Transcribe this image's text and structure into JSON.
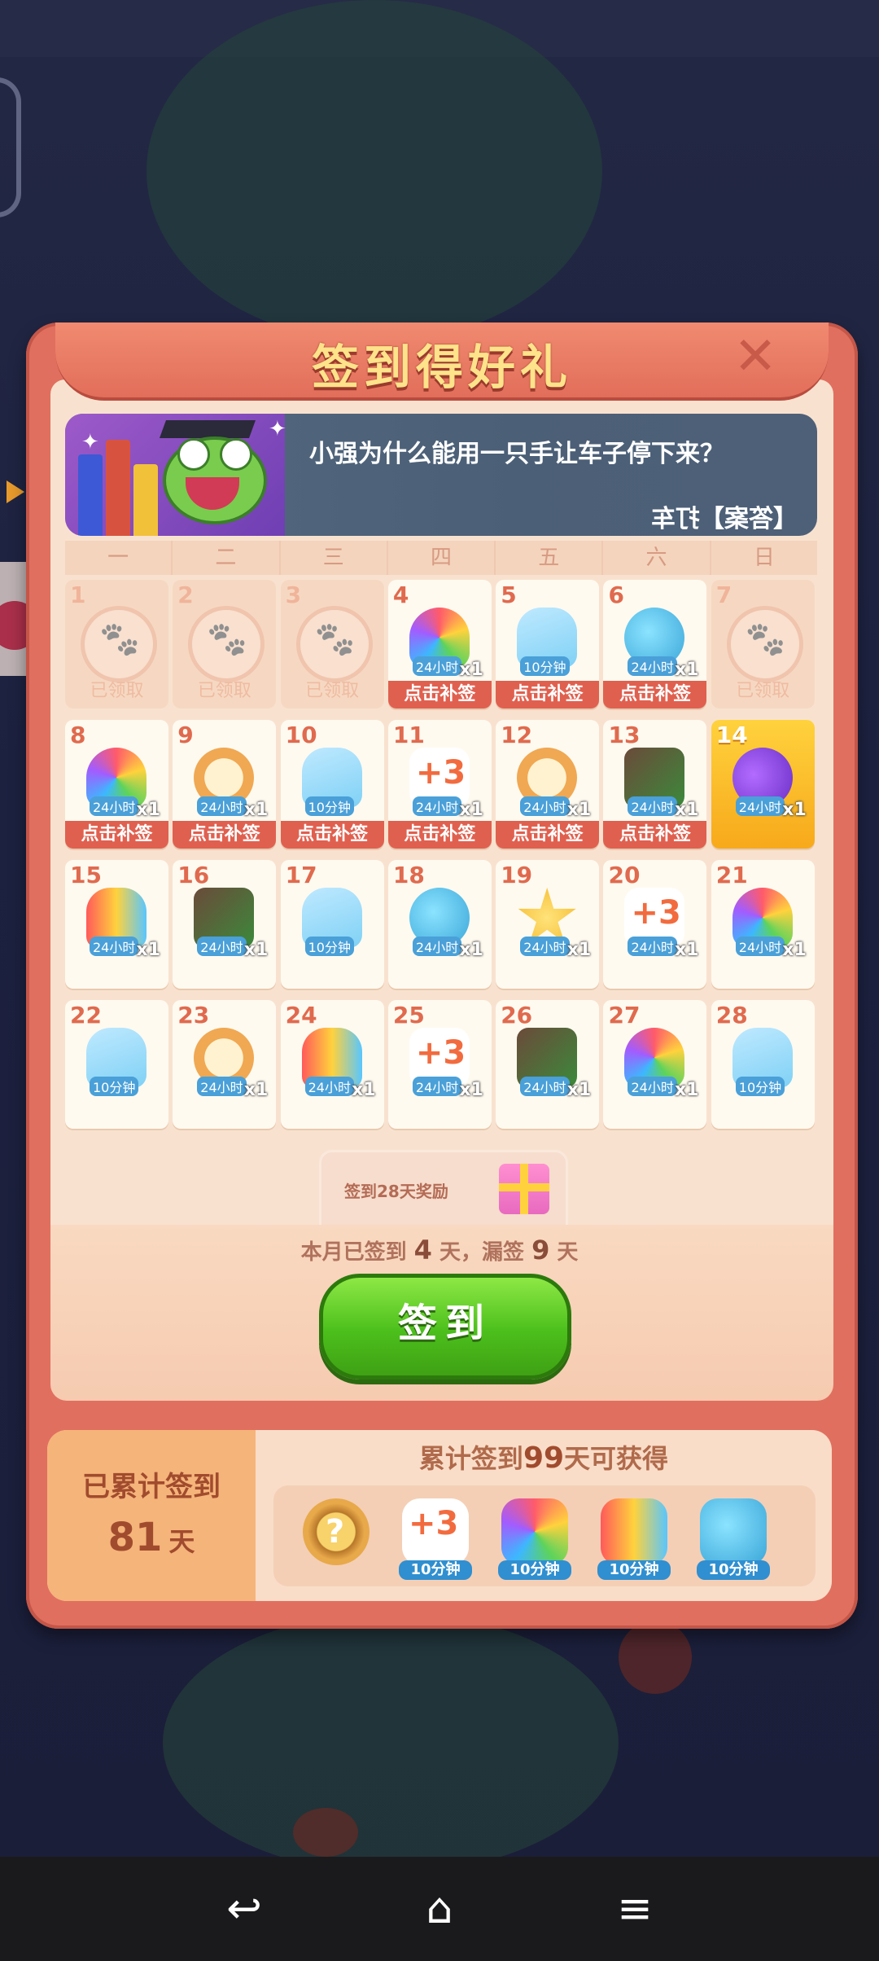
{
  "dialog": {
    "title": "签到得好礼",
    "close_icon": "close-icon"
  },
  "banner": {
    "question": "小强为什么能用一只手让车子停下来？",
    "tag": "【答案】打车"
  },
  "weekdays": [
    "一",
    "二",
    "三",
    "四",
    "五",
    "六",
    "日"
  ],
  "calendar": [
    {
      "day": "1",
      "state": "claimed",
      "label": "已领取"
    },
    {
      "day": "2",
      "state": "claimed",
      "label": "已领取"
    },
    {
      "day": "3",
      "state": "claimed",
      "label": "已领取"
    },
    {
      "day": "4",
      "state": "missed",
      "icon": "feather",
      "dur": "24小时",
      "count": "x1",
      "label": "点击补签"
    },
    {
      "day": "5",
      "state": "missed",
      "icon": "bottle",
      "dur": "10分钟",
      "count": "",
      "label": "点击补签"
    },
    {
      "day": "6",
      "state": "missed",
      "icon": "frog",
      "dur": "24小时",
      "count": "x1",
      "label": "点击补签"
    },
    {
      "day": "7",
      "state": "claimed",
      "label": "已领取"
    },
    {
      "day": "8",
      "state": "missed",
      "icon": "feather",
      "dur": "24小时",
      "count": "x1",
      "label": "点击补签"
    },
    {
      "day": "9",
      "state": "missed",
      "icon": "clock",
      "dur": "24小时",
      "count": "x1",
      "label": "点击补签"
    },
    {
      "day": "10",
      "state": "missed",
      "icon": "bottle",
      "dur": "10分钟",
      "count": "",
      "label": "点击补签"
    },
    {
      "day": "11",
      "state": "missed",
      "icon": "plus3",
      "dur": "24小时",
      "count": "x1",
      "label": "点击补签"
    },
    {
      "day": "12",
      "state": "missed",
      "icon": "clock",
      "dur": "24小时",
      "count": "x1",
      "label": "点击补签"
    },
    {
      "day": "13",
      "state": "missed",
      "icon": "block",
      "dur": "24小时",
      "count": "x1",
      "label": "点击补签"
    },
    {
      "day": "14",
      "state": "today",
      "icon": "bird",
      "dur": "24小时",
      "count": "x1",
      "label": ""
    },
    {
      "day": "15",
      "state": "future",
      "icon": "rocket",
      "dur": "24小时",
      "count": "x1"
    },
    {
      "day": "16",
      "state": "future",
      "icon": "block",
      "dur": "24小时",
      "count": "x1"
    },
    {
      "day": "17",
      "state": "future",
      "icon": "bottle",
      "dur": "10分钟",
      "count": ""
    },
    {
      "day": "18",
      "state": "future",
      "icon": "frog",
      "dur": "24小时",
      "count": "x1"
    },
    {
      "day": "19",
      "state": "future",
      "icon": "star",
      "dur": "24小时",
      "count": "x1"
    },
    {
      "day": "20",
      "state": "future",
      "icon": "plus3",
      "dur": "24小时",
      "count": "x1"
    },
    {
      "day": "21",
      "state": "future",
      "icon": "feather",
      "dur": "24小时",
      "count": "x1"
    },
    {
      "day": "22",
      "state": "future",
      "icon": "bottle",
      "dur": "10分钟",
      "count": ""
    },
    {
      "day": "23",
      "state": "future",
      "icon": "clock",
      "dur": "24小时",
      "count": "x1"
    },
    {
      "day": "24",
      "state": "future",
      "icon": "rocket",
      "dur": "24小时",
      "count": "x1"
    },
    {
      "day": "25",
      "state": "future",
      "icon": "plus3",
      "dur": "24小时",
      "count": "x1"
    },
    {
      "day": "26",
      "state": "future",
      "icon": "block",
      "dur": "24小时",
      "count": "x1"
    },
    {
      "day": "27",
      "state": "future",
      "icon": "feather",
      "dur": "24小时",
      "count": "x1"
    },
    {
      "day": "28",
      "state": "future",
      "icon": "bottle",
      "dur": "10分钟",
      "count": ""
    }
  ],
  "reward28": {
    "label": "签到28天奖励",
    "icon": "gift-icon"
  },
  "summary": {
    "prefix": "本月已签到",
    "signed": "4",
    "mid": "天，漏签",
    "missed": "9",
    "suffix": "天"
  },
  "checkin_button": "签到",
  "cumulative": {
    "label": "已累计签到",
    "days": "81",
    "unit": "天",
    "title_prefix": "累计签到",
    "title_days": "99",
    "title_suffix": "天可获得",
    "rewards": [
      {
        "icon": "medal",
        "label": ""
      },
      {
        "icon": "plus3",
        "label": "10分钟"
      },
      {
        "icon": "feather",
        "label": "10分钟"
      },
      {
        "icon": "rocket",
        "label": "10分钟"
      },
      {
        "icon": "frog",
        "label": "10分钟"
      }
    ]
  },
  "navbar": {
    "back": "↩",
    "home": "⌂",
    "menu": "≡"
  }
}
